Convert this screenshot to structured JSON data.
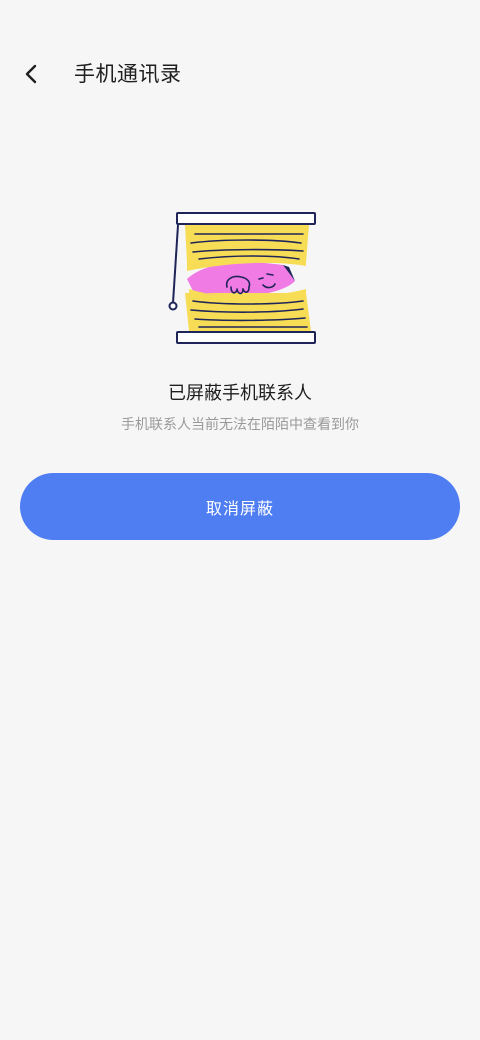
{
  "header": {
    "title": "手机通讯录",
    "back_icon": "back-arrow-icon"
  },
  "illustration": {
    "icon": "blinds-peek-icon"
  },
  "content": {
    "headline": "已屏蔽手机联系人",
    "subline": "手机联系人当前无法在陌陌中查看到你"
  },
  "actions": {
    "primary_label": "取消屏蔽"
  },
  "colors": {
    "background": "#f6f6f6",
    "primary": "#4f7ef3",
    "text_primary": "#1f1f1f",
    "text_secondary": "#9a9a9a",
    "blind_yellow": "#f7dd56",
    "character_pink": "#f07be5",
    "outline_navy": "#1f2558"
  }
}
